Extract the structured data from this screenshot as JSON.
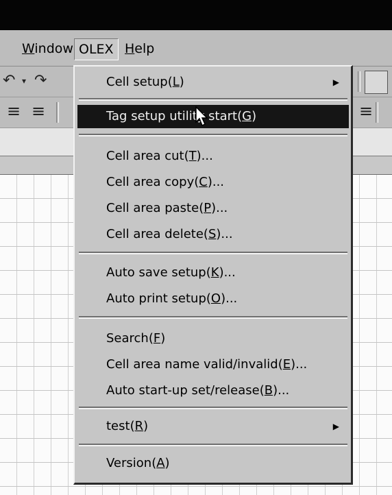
{
  "menubar": {
    "window": {
      "label": "Window",
      "key": "W",
      "rest": "indow"
    },
    "olex": {
      "label": "OLEX"
    },
    "help": {
      "label": "Help",
      "key": "H",
      "rest": "elp"
    }
  },
  "olex_menu": [
    {
      "pre": "Cell setup(",
      "key": "L",
      "post": ")",
      "submenu": true
    },
    {
      "pre": "Tag setup utility start(",
      "key": "G",
      "post": ")",
      "highlighted": true
    },
    {
      "pre": "Cell area cut(",
      "key": "T",
      "post": ")..."
    },
    {
      "pre": "Cell area copy(",
      "key": "C",
      "post": ")..."
    },
    {
      "pre": "Cell area paste(",
      "key": "P",
      "post": ")..."
    },
    {
      "pre": "Cell area delete(",
      "key": "S",
      "post": ")..."
    },
    {
      "pre": "Auto save setup(",
      "key": "K",
      "post": ")..."
    },
    {
      "pre": "Auto print setup(",
      "key": "O",
      "post": ")..."
    },
    {
      "pre": "Search(",
      "key": "F",
      "post": ")"
    },
    {
      "pre": "Cell area name valid/invalid(",
      "key": "E",
      "post": ")..."
    },
    {
      "pre": "Auto start-up set/release(",
      "key": "B",
      "post": ")..."
    },
    {
      "pre": "test(",
      "key": "R",
      "post": ")",
      "submenu": true
    },
    {
      "pre": "Version(",
      "key": "A",
      "post": ")"
    }
  ],
  "colors": {
    "highlight_bg": "#151515",
    "menu_bg": "#c6c6c6"
  }
}
